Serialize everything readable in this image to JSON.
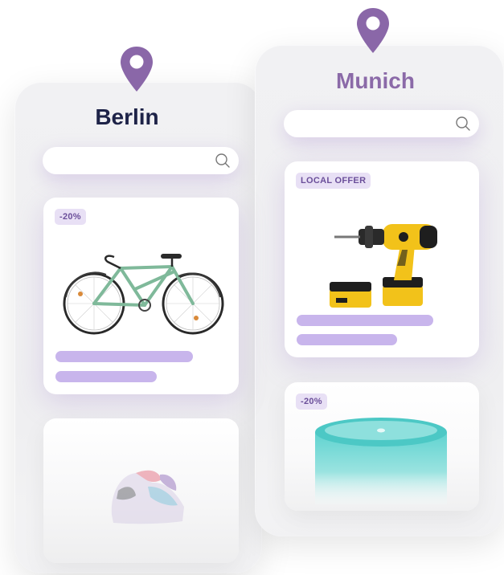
{
  "locations": {
    "berlin": {
      "name": "Berlin",
      "cards": [
        {
          "badge": "-20%",
          "product": "bicycle-image"
        },
        {
          "badge": "",
          "product": "sneaker-image"
        }
      ]
    },
    "munich": {
      "name": "Munich",
      "cards": [
        {
          "badge": "LOCAL OFFER",
          "product": "power-drill-image"
        },
        {
          "badge": "-20%",
          "product": "smart-speaker-image"
        }
      ]
    }
  },
  "colors": {
    "pin": "#8a67a8",
    "berlin_title": "#1e2348",
    "munich_title": "#8b6aa8",
    "placeholder_bar": "#c8b5ec",
    "badge_bg": "#e8e0f5",
    "badge_text": "#6b4f9a"
  },
  "icons": [
    "location-pin-icon",
    "search-icon"
  ]
}
